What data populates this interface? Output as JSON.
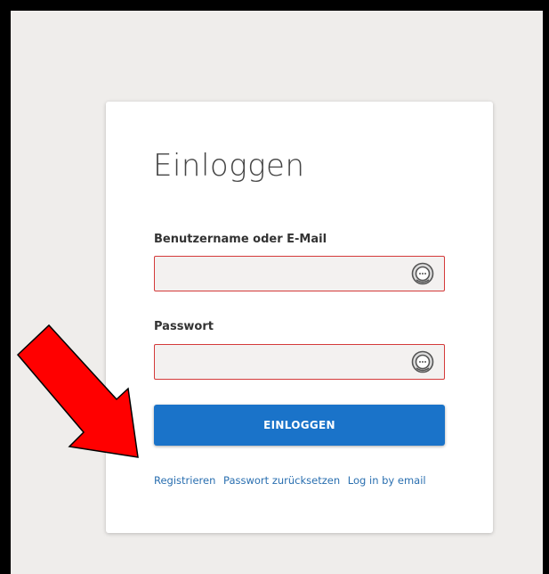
{
  "login": {
    "title": "Einloggen",
    "username_label": "Benutzername oder E-Mail",
    "username_value": "",
    "password_label": "Passwort",
    "password_value": "",
    "submit_label": "EINLOGGEN",
    "links": {
      "register": "Registrieren",
      "reset_password": "Passwort zurücksetzen",
      "email_login": "Log in by email"
    }
  },
  "icons": {
    "password_manager": "password-manager-icon",
    "annotation": "red-arrow-icon"
  },
  "colors": {
    "background": "#efedeb",
    "button": "#1a73c9",
    "field_border": "#d43a3a",
    "link": "#2a6fb0",
    "arrow": "#ff0000"
  }
}
